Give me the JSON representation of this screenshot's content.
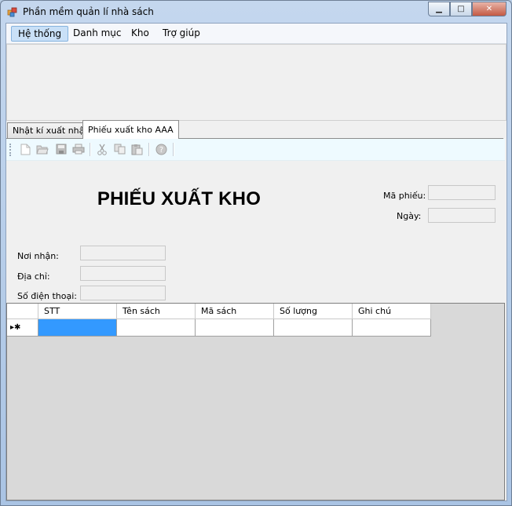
{
  "window": {
    "title": "Phần mềm quản lí nhà sách",
    "icon": "app-icon",
    "buttons": {
      "minimize": "minimize-icon",
      "maximize": "maximize-icon",
      "close": "close-icon"
    }
  },
  "menu": {
    "items": [
      {
        "label": "Hệ thống",
        "active": true
      },
      {
        "label": "Danh mục"
      },
      {
        "label": "Kho"
      },
      {
        "label": "Trợ giúp"
      }
    ]
  },
  "tabs": [
    {
      "label": "Nhật kí xuất nhập"
    },
    {
      "label": "Phiếu xuất kho AAA",
      "selected": true
    }
  ],
  "toolbar": {
    "icons": [
      "new-document-icon",
      "open-folder-icon",
      "save-icon",
      "print-icon",
      "cut-icon",
      "copy-icon",
      "paste-icon",
      "help-icon"
    ]
  },
  "form": {
    "heading": "PHIẾU XUẤT KHO",
    "ma_phieu_label": "Mã phiếu:",
    "ngay_label": "Ngày:",
    "noi_nhan_label": "Nơi nhận:",
    "dia_chi_label": "Địa chỉ:",
    "so_dien_thoai_label": "Số điện thoại:"
  },
  "grid": {
    "columns": [
      "STT",
      "Tên sách",
      "Mã sách",
      "Số lượng",
      "Ghi chú"
    ],
    "new_row_marker": "▸✱"
  },
  "colors": {
    "selected_cell": "#3399ff",
    "grid_background": "#d9d9d9",
    "toolbar_background": "#eefaff"
  }
}
